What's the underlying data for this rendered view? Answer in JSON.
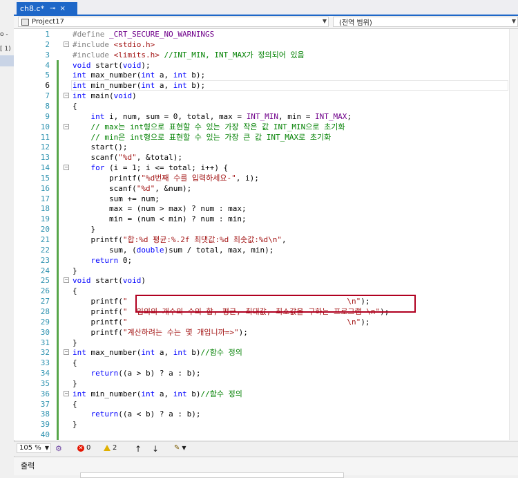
{
  "left_strip": {
    "item_1": "o -",
    "item_2": "[ 1)"
  },
  "tab": {
    "filename": "ch8.c*",
    "pin": "⊸",
    "close": "×"
  },
  "navbar": {
    "project": "Project17",
    "scope": "(전역 범위)"
  },
  "editor": {
    "line_numbers": [
      "1",
      "2",
      "3",
      "4",
      "5",
      "6",
      "7",
      "8",
      "9",
      "10",
      "11",
      "12",
      "13",
      "14",
      "15",
      "16",
      "17",
      "18",
      "19",
      "20",
      "21",
      "22",
      "23",
      "24",
      "25",
      "26",
      "27",
      "28",
      "29",
      "30",
      "31",
      "32",
      "33",
      "34",
      "35",
      "36",
      "37",
      "38",
      "39",
      "40"
    ],
    "current_line": 6,
    "code_lines": [
      "#define _CRT_SECURE_NO_WARNINGS",
      "#include <stdio.h>",
      "#include <limits.h> //INT_MIN, INT_MAX가 정의되어 있음",
      "void start(void);",
      "int max_number(int a, int b);",
      "int min_number(int a, int b);",
      "int main(void)",
      "{",
      "    int i, num, sum = 0, total, max = INT_MIN, min = INT_MAX;",
      "    // max는 int형으로 표현할 수 있는 가장 작은 값 INT_MIN으로 초기화",
      "    // min은 int형으로 표현할 수 있는 가장 큰 값 INT_MAX로 초기화",
      "    start();",
      "    scanf(\"%d\", &total);",
      "    for (i = 1; i <= total; i++) {",
      "        printf(\"%d번째 수를 입력하세요-\", i);",
      "        scanf(\"%d\", &num);",
      "        sum += num;",
      "        max = (num > max) ? num : max;",
      "        min = (num < min) ? num : min;",
      "    }",
      "    printf(\"합:%d 평균:%.2f 최댓값:%d 최솟값:%d\\n\",",
      "        sum, (double)sum / total, max, min);",
      "    return 0;",
      "}",
      "void start(void)",
      "{",
      "    printf(\"                                                \\n\");",
      "    printf(\"  임의의 개수의 수의 합, 평균, 최대값, 최소값을 구하는 프로그램 \\n\");",
      "    printf(\"                                                \\n\");",
      "    printf(\"계산하려는 수는 몇 개입니까=>\");",
      "}",
      "int max_number(int a, int b)//함수 정의",
      "{",
      "    return((a > b) ? a : b);",
      "}",
      "int min_number(int a, int b)//함수 정의",
      "{",
      "    return((a < b) ? a : b);",
      "}",
      ""
    ]
  },
  "statusbar": {
    "zoom": "105 %",
    "errors": "0",
    "warnings": "2",
    "up_arrow": "↑",
    "down_arrow": "↓"
  },
  "output_panel": {
    "title": "출력"
  },
  "colors": {
    "tab_active": "#1e67c8",
    "keyword": "#0000ff",
    "string": "#a31515",
    "comment": "#008000",
    "macro": "#6f008a",
    "line_number": "#2b91af",
    "highlight_box": "#b00020"
  }
}
